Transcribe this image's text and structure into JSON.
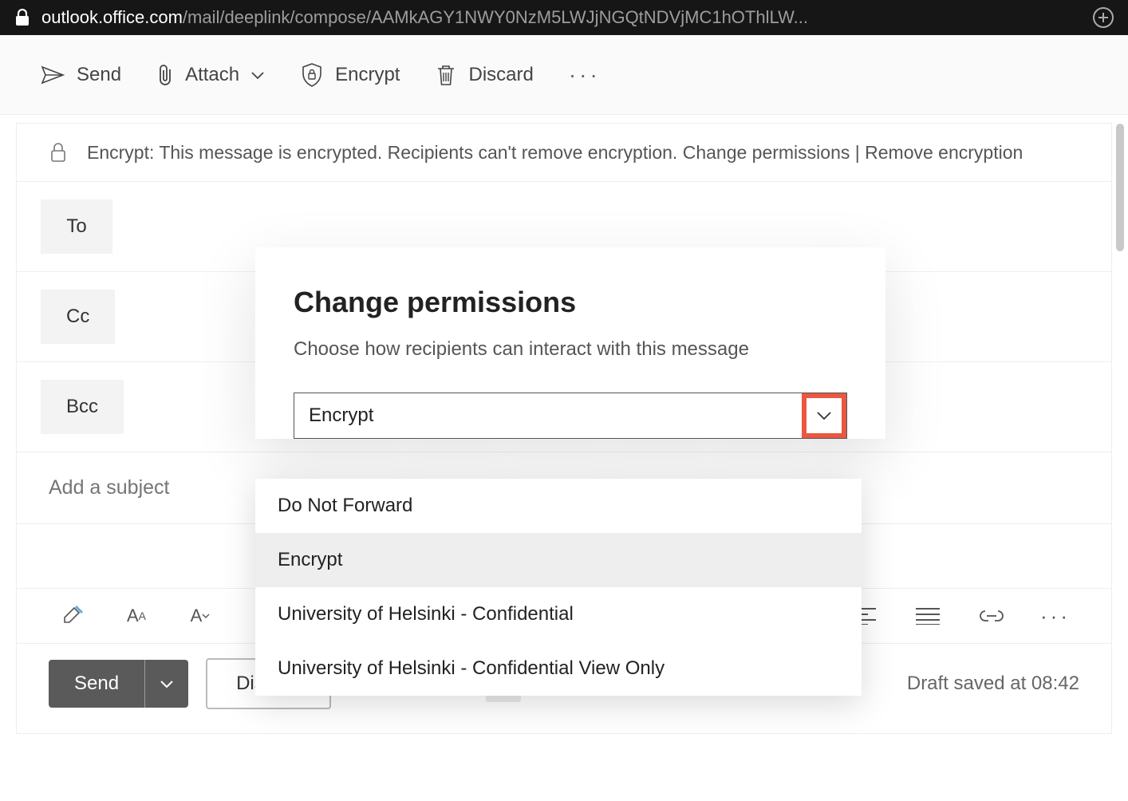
{
  "addressbar": {
    "host": "outlook.office.com",
    "path": "/mail/deeplink/compose/AAMkAGY1NWY0NzM5LWJjNGQtNDVjMC1hOThlLW..."
  },
  "cmdbar": {
    "send": "Send",
    "attach": "Attach",
    "encrypt": "Encrypt",
    "discard": "Discard"
  },
  "banner": {
    "prefix": "Encrypt: ",
    "text": "This message is encrypted. Recipients can't remove encryption.",
    "change": "Change permissions",
    "sep": " | ",
    "remove": "Remove encryption"
  },
  "fields": {
    "to": "To",
    "cc": "Cc",
    "bcc": "Bcc",
    "subject_placeholder": "Add a subject"
  },
  "dialog": {
    "title": "Change permissions",
    "hint": "Choose how recipients can interact with this message",
    "selected": "Encrypt",
    "options": [
      "Do Not Forward",
      "Encrypt",
      "University of Helsinki - Confidential",
      "University of Helsinki - Confidential View Only"
    ]
  },
  "bottom": {
    "send": "Send",
    "discard": "Discard",
    "draft_status": "Draft saved at 08:42"
  }
}
